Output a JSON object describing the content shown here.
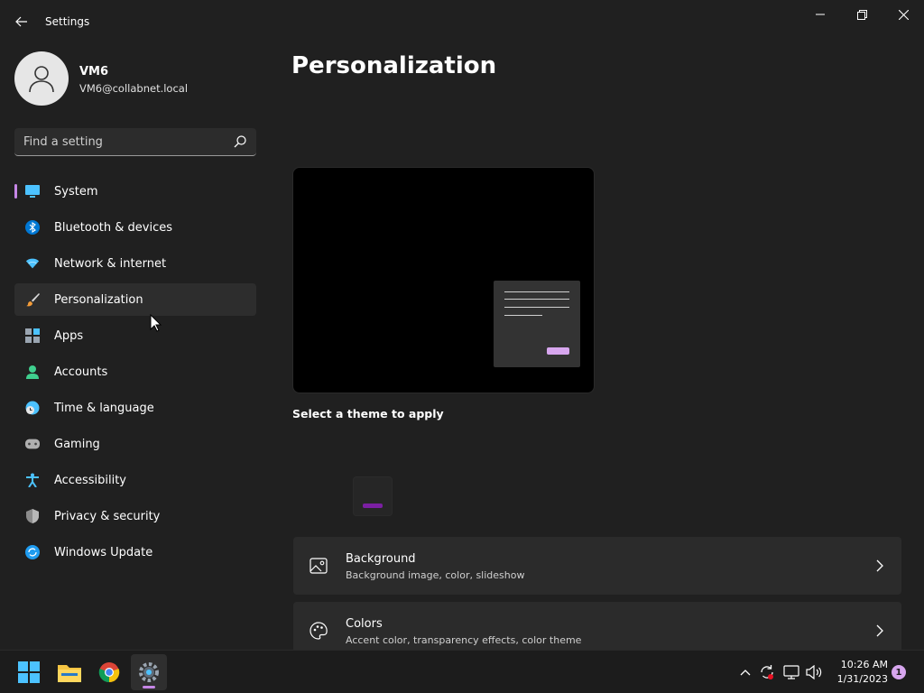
{
  "window": {
    "title": "Settings"
  },
  "user": {
    "name": "VM6",
    "email": "VM6@collabnet.local"
  },
  "search": {
    "placeholder": "Find a setting"
  },
  "nav": {
    "items": [
      {
        "label": "System",
        "icon": "monitor-icon"
      },
      {
        "label": "Bluetooth & devices",
        "icon": "bluetooth-icon"
      },
      {
        "label": "Network & internet",
        "icon": "wifi-icon"
      },
      {
        "label": "Personalization",
        "icon": "brush-icon",
        "selected": true
      },
      {
        "label": "Apps",
        "icon": "apps-icon"
      },
      {
        "label": "Accounts",
        "icon": "person-icon"
      },
      {
        "label": "Time & language",
        "icon": "globe-clock-icon"
      },
      {
        "label": "Gaming",
        "icon": "gamepad-icon"
      },
      {
        "label": "Accessibility",
        "icon": "accessibility-icon"
      },
      {
        "label": "Privacy & security",
        "icon": "shield-icon"
      },
      {
        "label": "Windows Update",
        "icon": "update-icon"
      }
    ]
  },
  "main": {
    "title": "Personalization",
    "select_theme_label": "Select a theme to apply",
    "cards": [
      {
        "title": "Background",
        "subtitle": "Background image, color, slideshow",
        "icon": "image-icon"
      },
      {
        "title": "Colors",
        "subtitle": "Accent color, transparency effects, color theme",
        "icon": "palette-icon"
      }
    ]
  },
  "taskbar": {
    "apps": [
      "start-icon",
      "file-explorer-icon",
      "chrome-icon",
      "settings-icon"
    ],
    "clock": {
      "time": "10:26 AM",
      "date": "1/31/2023"
    },
    "notification_count": "1"
  },
  "colors": {
    "accent": "#c686e6",
    "background": "#202020",
    "card": "#2b2b2b"
  }
}
